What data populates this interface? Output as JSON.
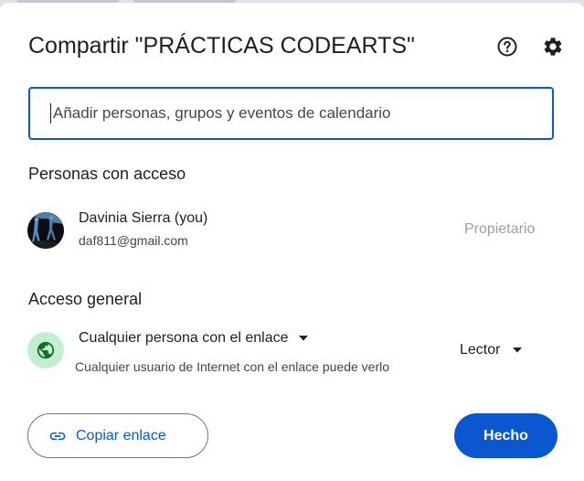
{
  "dialog": {
    "title": "Compartir \"PRÁCTICAS CODEARTS\"",
    "help_icon": "help-circle-icon",
    "settings_icon": "gear-icon"
  },
  "search": {
    "placeholder": "Añadir personas, grupos y eventos de calendario",
    "value": ""
  },
  "people": {
    "heading": "Personas con acceso",
    "items": [
      {
        "name": "Davinia Sierra (you)",
        "email": "daf811@gmail.com",
        "role": "Propietario"
      }
    ]
  },
  "general_access": {
    "heading": "Acceso general",
    "icon": "globe-icon",
    "selected": "Cualquier persona con el enlace",
    "description": "Cualquier usuario de Internet con el enlace puede verlo",
    "role": "Lector"
  },
  "footer": {
    "copy_link_label": "Copiar enlace",
    "copy_link_icon": "link-icon",
    "done_label": "Hecho"
  },
  "colors": {
    "primary": "#0b57d0",
    "globe_bg": "#c4eed0",
    "globe": "#146c2e",
    "muted_role": "#9aa0a6"
  }
}
